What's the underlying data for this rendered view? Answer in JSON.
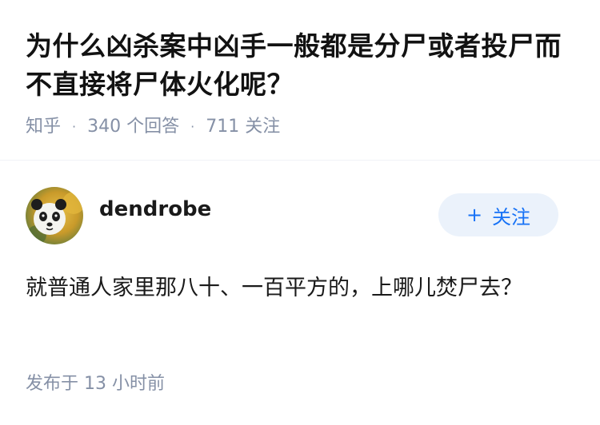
{
  "question": {
    "title": "为什么凶杀案中凶手一般都是分尸或者投尸而不直接将尸体火化呢？",
    "source": "知乎",
    "separator": "·",
    "answers_count": "340 个回答",
    "followers_count": "711 关注"
  },
  "answer": {
    "author": {
      "name": "dendrobe",
      "avatar_icon": "panda-avatar"
    },
    "follow_button": {
      "plus": "+",
      "label": "关注"
    },
    "content": "就普通人家里那八十、一百平方的，上哪儿焚尸去？",
    "published": "发布于 13 小时前"
  },
  "colors": {
    "accent": "#1772f6",
    "follow_bg": "#ebf2fb",
    "meta_text": "#8590a6",
    "title_text": "#121212"
  }
}
